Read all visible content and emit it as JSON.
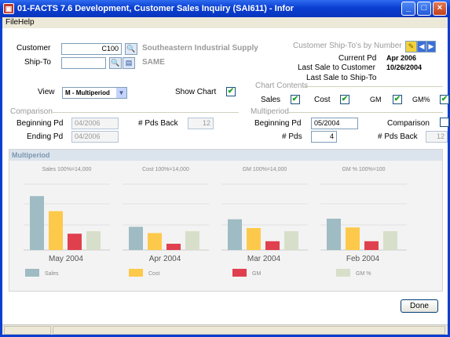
{
  "window": {
    "title": "01-FACTS 7.6 Development, Customer Sales Inquiry (SAI611) - Infor"
  },
  "menu": {
    "items": [
      "File",
      "Help"
    ]
  },
  "customer": {
    "customer_label": "Customer",
    "customer_value": "C100",
    "customer_name": "Southeastern Industrial Supply",
    "shipto_label": "Ship-To",
    "shipto_value": "",
    "shipto_name": "SAME"
  },
  "shipto_by_number": {
    "label": "Customer Ship-To's by Number"
  },
  "info": {
    "current_pd_label": "Current Pd",
    "current_pd_value": "Apr 2006",
    "last_sale_customer_label": "Last Sale to Customer",
    "last_sale_customer_value": "10/26/2004",
    "last_sale_shipto_label": "Last Sale to Ship-To",
    "last_sale_shipto_value": ""
  },
  "view": {
    "label": "View",
    "selected": "M - Multiperiod",
    "show_chart_label": "Show Chart",
    "show_chart_checked": "✔"
  },
  "chart_contents": {
    "label": "Chart Contents",
    "items": [
      {
        "label": "Sales",
        "mark": "✔"
      },
      {
        "label": "Cost",
        "mark": "✔"
      },
      {
        "label": "GM",
        "mark": "✔"
      },
      {
        "label": "GM%",
        "mark": "✔"
      }
    ]
  },
  "comparison": {
    "label": "Comparison",
    "beginning_pd_label": "Beginning Pd",
    "beginning_pd_value": "04/2006",
    "ending_pd_label": "Ending Pd",
    "ending_pd_value": "04/2006",
    "pds_back_label": "# Pds Back",
    "pds_back_value": "12"
  },
  "multiperiod": {
    "label": "Multiperiod",
    "beginning_pd_label": "Beginning Pd",
    "beginning_pd_value": "05/2004",
    "pds_label": "# Pds",
    "pds_value": "4",
    "comparison_label": "Comparison",
    "comparison_checked": "",
    "pds_back_label": "# Pds Back",
    "pds_back_value": "12"
  },
  "panel": {
    "title": "Multiperiod"
  },
  "chart_data": {
    "type": "bar",
    "scale_labels": [
      "Sales 100%=14,000",
      "Cost 100%=14,000",
      "GM 100%=14,000",
      "GM % 100%=100"
    ],
    "categories": [
      "May 2004",
      "Apr 2004",
      "Mar 2004",
      "Feb 2004"
    ],
    "series": [
      {
        "name": "Sales",
        "color": "#9fbbc3",
        "values": [
          86,
          37,
          49,
          50
        ]
      },
      {
        "name": "Cost",
        "color": "#fdc94b",
        "values": [
          62,
          27,
          35,
          36
        ]
      },
      {
        "name": "GM",
        "color": "#e0404e",
        "values": [
          26,
          10,
          14,
          14
        ]
      },
      {
        "name": "GM %",
        "color": "#d7dfca",
        "values": [
          30,
          30,
          30,
          30
        ]
      }
    ],
    "ylim": [
      0,
      100
    ],
    "legend": "bottom"
  },
  "buttons": {
    "done": "Done"
  }
}
